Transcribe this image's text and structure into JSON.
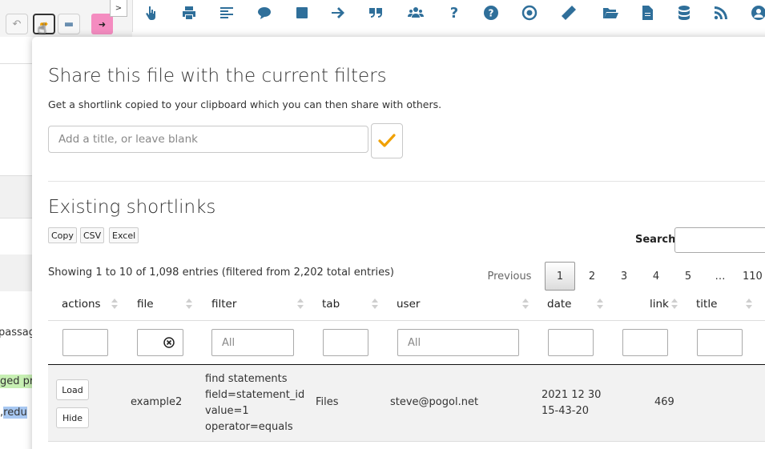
{
  "toolbar_left": {
    "gt_label": ">",
    "undo_icon": "undo-icon",
    "share_icon": "share-icon",
    "comments_icon": "comments-icon",
    "logout_icon": "logout-icon",
    "logout_color": "#f48cc0"
  },
  "toolbar": {
    "icons": [
      "pointer-icon",
      "print-icon",
      "align-left-icon",
      "comment-icon",
      "square-icon",
      "arrow-right-icon",
      "quote-icon",
      "users-icon",
      "question-icon",
      "help-circle-icon",
      "target-icon",
      "ruler-icon",
      "folder-open-icon",
      "file-icon",
      "database-icon",
      "rss-icon",
      "user-circle-icon"
    ],
    "icon_color": "#2f6f9a"
  },
  "background_fragments": {
    "passage": "passage",
    "green": "ged pr",
    "comma": ",",
    "blue": "redu"
  },
  "share": {
    "title": "Share this file with the current filters",
    "subtitle": "Get a shortlink copied to your clipboard which you can then share with others.",
    "input_placeholder": "Add a title, or leave blank",
    "confirm_color": "#f0a000"
  },
  "shortlinks": {
    "title": "Existing shortlinks",
    "export_buttons": [
      "Copy",
      "CSV",
      "Excel"
    ],
    "search_label": "Search:",
    "info": "Showing 1 to 10 of 1,098 entries (filtered from 2,202 total entries)",
    "pagination": {
      "previous": "Previous",
      "pages": [
        "1",
        "2",
        "3",
        "4",
        "5",
        "…",
        "110"
      ],
      "current": "1"
    },
    "columns": [
      "actions",
      "file",
      "filter",
      "tab",
      "user",
      "date",
      "link",
      "title"
    ],
    "filter_placeholders": {
      "filter": "All",
      "user": "All"
    },
    "rows": [
      {
        "actions": [
          "Load",
          "Hide"
        ],
        "file": "example2",
        "filter_lines": [
          "find statements",
          "field=statement_id",
          "value=1",
          "operator=equals"
        ],
        "tab": "Files",
        "user": "steve@pogol.net",
        "date_lines": [
          "2021 12 30",
          "15-43-20"
        ],
        "link": "469",
        "title": ""
      }
    ]
  }
}
